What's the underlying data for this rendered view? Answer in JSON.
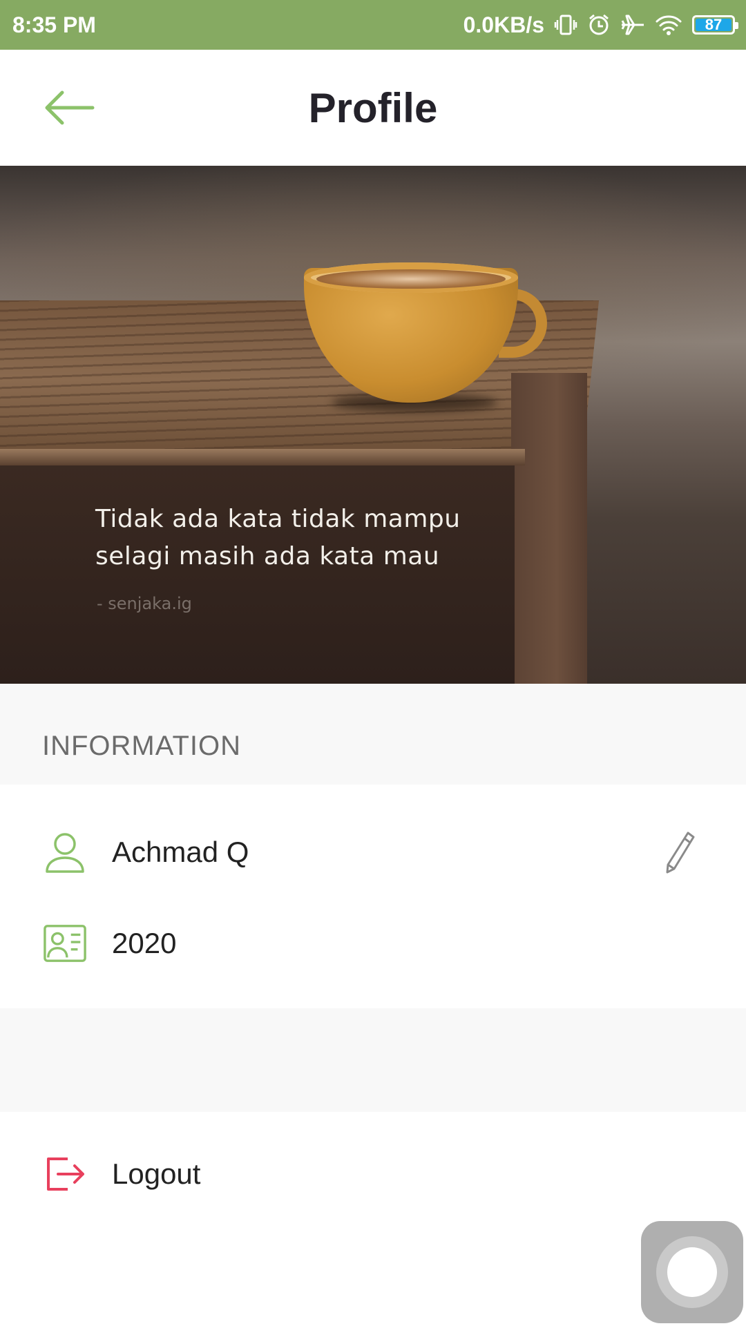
{
  "status_bar": {
    "time": "8:35 PM",
    "net_speed": "0.0KB/s",
    "battery": "87",
    "icons": [
      "vibrate-icon",
      "alarm-icon",
      "airplane-icon",
      "wifi-icon",
      "battery-icon"
    ]
  },
  "header": {
    "title": "Profile",
    "back_icon": "arrow-left-icon"
  },
  "banner": {
    "quote_line1": "Tidak ada kata tidak mampu",
    "quote_line2": "selagi masih ada kata mau",
    "author": "- senjaka.ig"
  },
  "information": {
    "section_title": "INFORMATION",
    "name": "Achmad Q",
    "year": "2020"
  },
  "logout": {
    "label": "Logout"
  },
  "colors": {
    "accent": "#86aa62",
    "icon_green": "#8cc26a",
    "logout_red": "#e8405d",
    "battery_fill": "#1ea7e8"
  }
}
